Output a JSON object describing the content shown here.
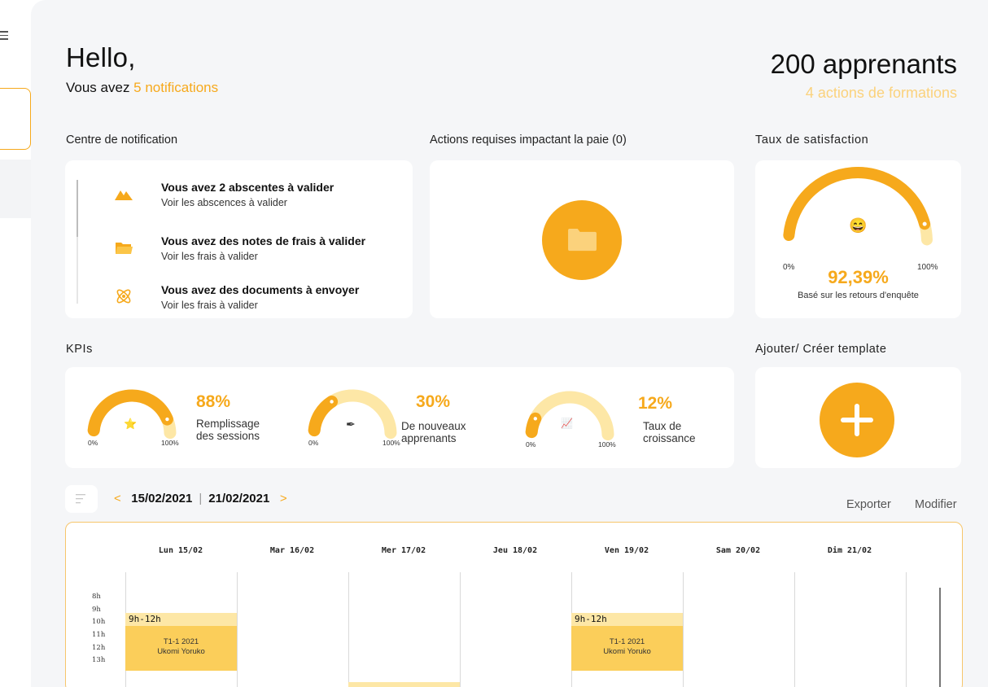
{
  "greeting": {
    "hello": "Hello,",
    "notif_prefix": "Vous avez ",
    "notif_accent": "5 notifications",
    "apprenants": "200 apprenants",
    "actions_formations": "4 actions de formations"
  },
  "sections": {
    "notification_center": "Centre de notification",
    "actions_paie": "Actions requises impactant la paie (0)",
    "satisfaction": "Taux de satisfaction",
    "kpis": "KPIs",
    "template": "Ajouter/ Créer template"
  },
  "notifications": [
    {
      "title": "Vous avez 2 abscentes à valider",
      "subtitle": "Voir les abscences à valider",
      "icon": "mountain-icon"
    },
    {
      "title": "Vous avez des notes de frais à valider",
      "subtitle": "Voir les frais à valider",
      "icon": "folder-icon"
    },
    {
      "title": "Vous avez des documents à envoyer",
      "subtitle": "Voir les frais à valider",
      "icon": "atom-icon"
    }
  ],
  "satisfaction": {
    "value": "92,39%",
    "fraction": 0.9239,
    "min_label": "0%",
    "max_label": "100%",
    "subtitle": "Basé sur les retours d'enquête",
    "emoji": "😄"
  },
  "kpis": [
    {
      "value": "88%",
      "fraction": 0.88,
      "label_line1": "Remplissage",
      "label_line2": "des sessions",
      "emoji": "⭐",
      "min": "0%",
      "max": "100%"
    },
    {
      "value": "30%",
      "fraction": 0.3,
      "label_line1": "De nouveaux",
      "label_line2": "apprenants",
      "emoji": "✒",
      "min": "0%",
      "max": "100%"
    },
    {
      "value": "12%",
      "fraction": 0.12,
      "label_line1": "Taux de",
      "label_line2": "croissance",
      "emoji": "📈",
      "min": "0%",
      "max": "100%"
    }
  ],
  "calendar": {
    "start_date": "15/02/2021",
    "end_date": "21/02/2021",
    "prev": "<",
    "next": ">",
    "export": "Exporter",
    "modify": "Modifier",
    "days": [
      "Lun 15/02",
      "Mar 16/02",
      "Mer 17/02",
      "Jeu 18/02",
      "Ven 19/02",
      "Sam 20/02",
      "Dim 21/02"
    ],
    "hours": [
      "8h",
      "9h",
      "10h",
      "11h",
      "12h",
      "13h"
    ],
    "events": [
      {
        "time": "9h-12h",
        "title": "T1-1 2021",
        "person": "Ukomi Yoruko",
        "day": "Lun 15/02"
      },
      {
        "time": "9h-12h",
        "title": "T1-1 2021",
        "person": "Ukomi Yoruko",
        "day": "Ven 19/02"
      }
    ]
  },
  "colors": {
    "accent": "#f6a91c",
    "accent_light": "#fde7a6",
    "event": "#fbce5a",
    "background": "#f5f6f8"
  }
}
